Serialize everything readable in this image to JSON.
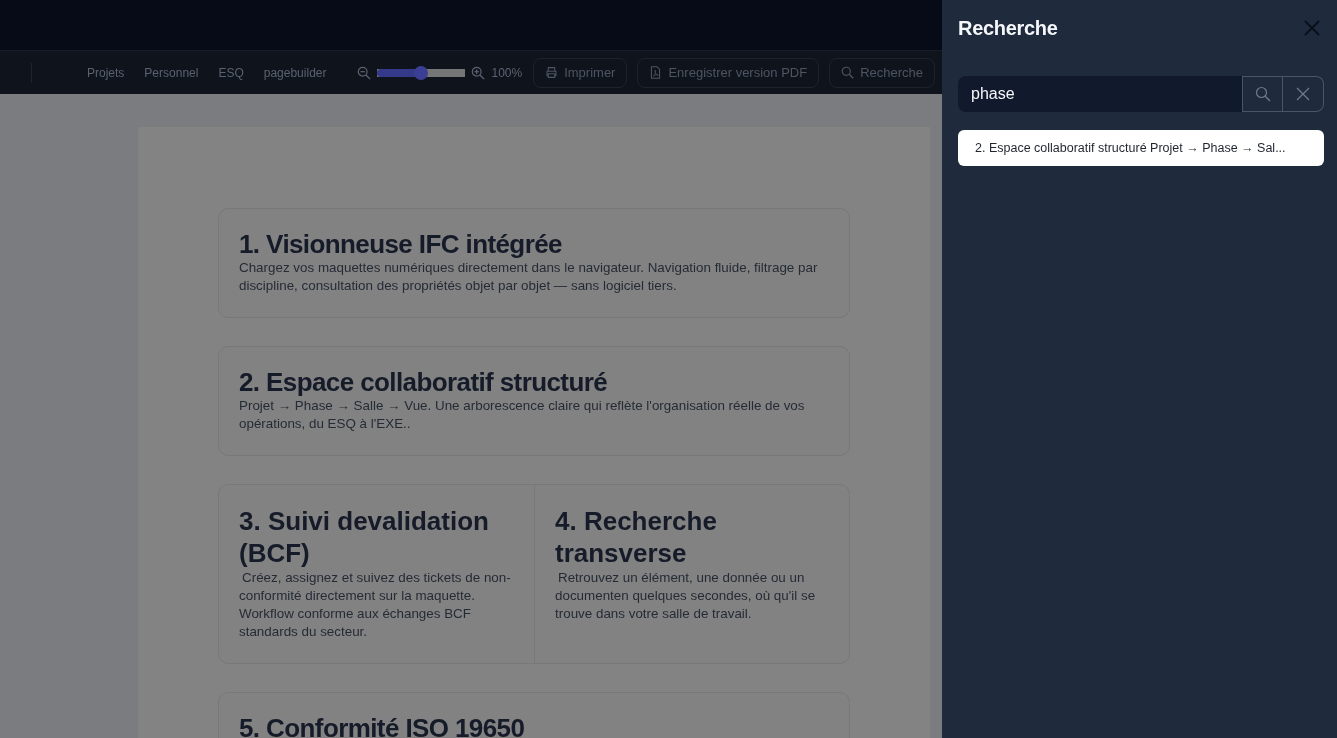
{
  "toolbar": {
    "nav_links": [
      {
        "label": "Projets"
      },
      {
        "label": "Personnel"
      },
      {
        "label": "ESQ"
      },
      {
        "label": "pagebuilder"
      }
    ],
    "zoom": {
      "level": 0.5,
      "reading": "100%"
    },
    "buttons": [
      {
        "kind": "print",
        "label": "Imprimer"
      },
      {
        "kind": "pdf",
        "label": "Enregistrer version PDF"
      },
      {
        "kind": "search",
        "label": "Recherche"
      }
    ]
  },
  "document": {
    "sections": [
      {
        "kind": "single",
        "title": "1. Visionneuse IFC intégrée",
        "text": "Chargez vos maquettes numériques directement dans le navigateur. Navigation fluide, filtrage par discipline, consultation des propriétés objet par objet — sans logiciel tiers."
      },
      {
        "kind": "single",
        "title": "2. Espace collaboratif structuré",
        "text": "Projet → Phase → Salle → Vue. Une arborescence claire qui reflète l'organisation réelle de vos opérations, du ESQ à l'EXE.."
      },
      {
        "kind": "split",
        "columns": [
          {
            "title": "3. Suivi devalidation (BCF)",
            "text": "Créez, assignez et suivez des tickets de non-conformité directement sur la maquette. Workflow conforme aux échanges BCF standards du secteur."
          },
          {
            "title": "4. Recherche transverse",
            "text": "Retrouvez un élément, une donnée ou un documenten quelques secondes, où qu'il se trouve dans votre salle de travail."
          }
        ]
      },
      {
        "kind": "single",
        "title": "5. Conformité ISO 19650"
      }
    ]
  },
  "search_panel": {
    "title": "Recherche",
    "query": "phase",
    "results": [
      {
        "label": "2. Espace collaboratif structuré Projet → Phase → Sal..."
      }
    ]
  }
}
